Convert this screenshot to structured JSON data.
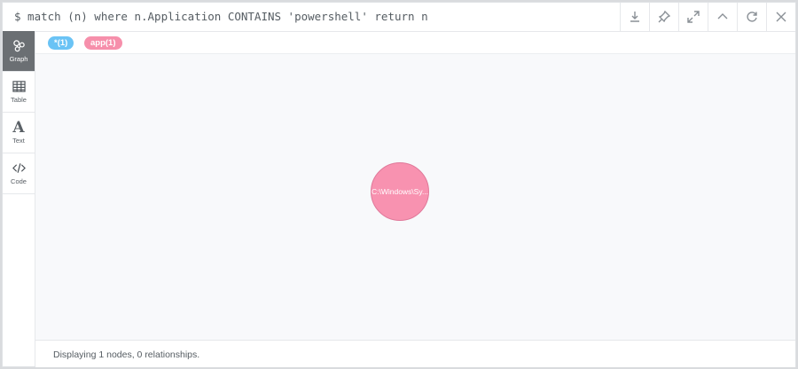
{
  "query": {
    "text": "$ match (n) where n.Application CONTAINS 'powershell' return n"
  },
  "toolbar": {
    "buttons": [
      "download-icon",
      "pin-icon",
      "expand-icon",
      "collapse-icon",
      "rerun-icon",
      "close-icon"
    ]
  },
  "sidebar": {
    "items": [
      {
        "label": "Graph",
        "icon": "graph-icon",
        "active": true
      },
      {
        "label": "Table",
        "icon": "table-icon",
        "active": false
      },
      {
        "label": "Text",
        "icon": "text-icon",
        "active": false
      },
      {
        "label": "Code",
        "icon": "code-icon",
        "active": false
      }
    ]
  },
  "legend": {
    "all_label": "*(1)",
    "app_label": "app(1)",
    "all_color": "#6ac3f5",
    "app_color": "#f68fab"
  },
  "graph": {
    "nodes": [
      {
        "label": "C:\\Windows\\Sy...",
        "color": "#f892b0"
      }
    ]
  },
  "status": {
    "text": "Displaying 1 nodes, 0 relationships."
  }
}
